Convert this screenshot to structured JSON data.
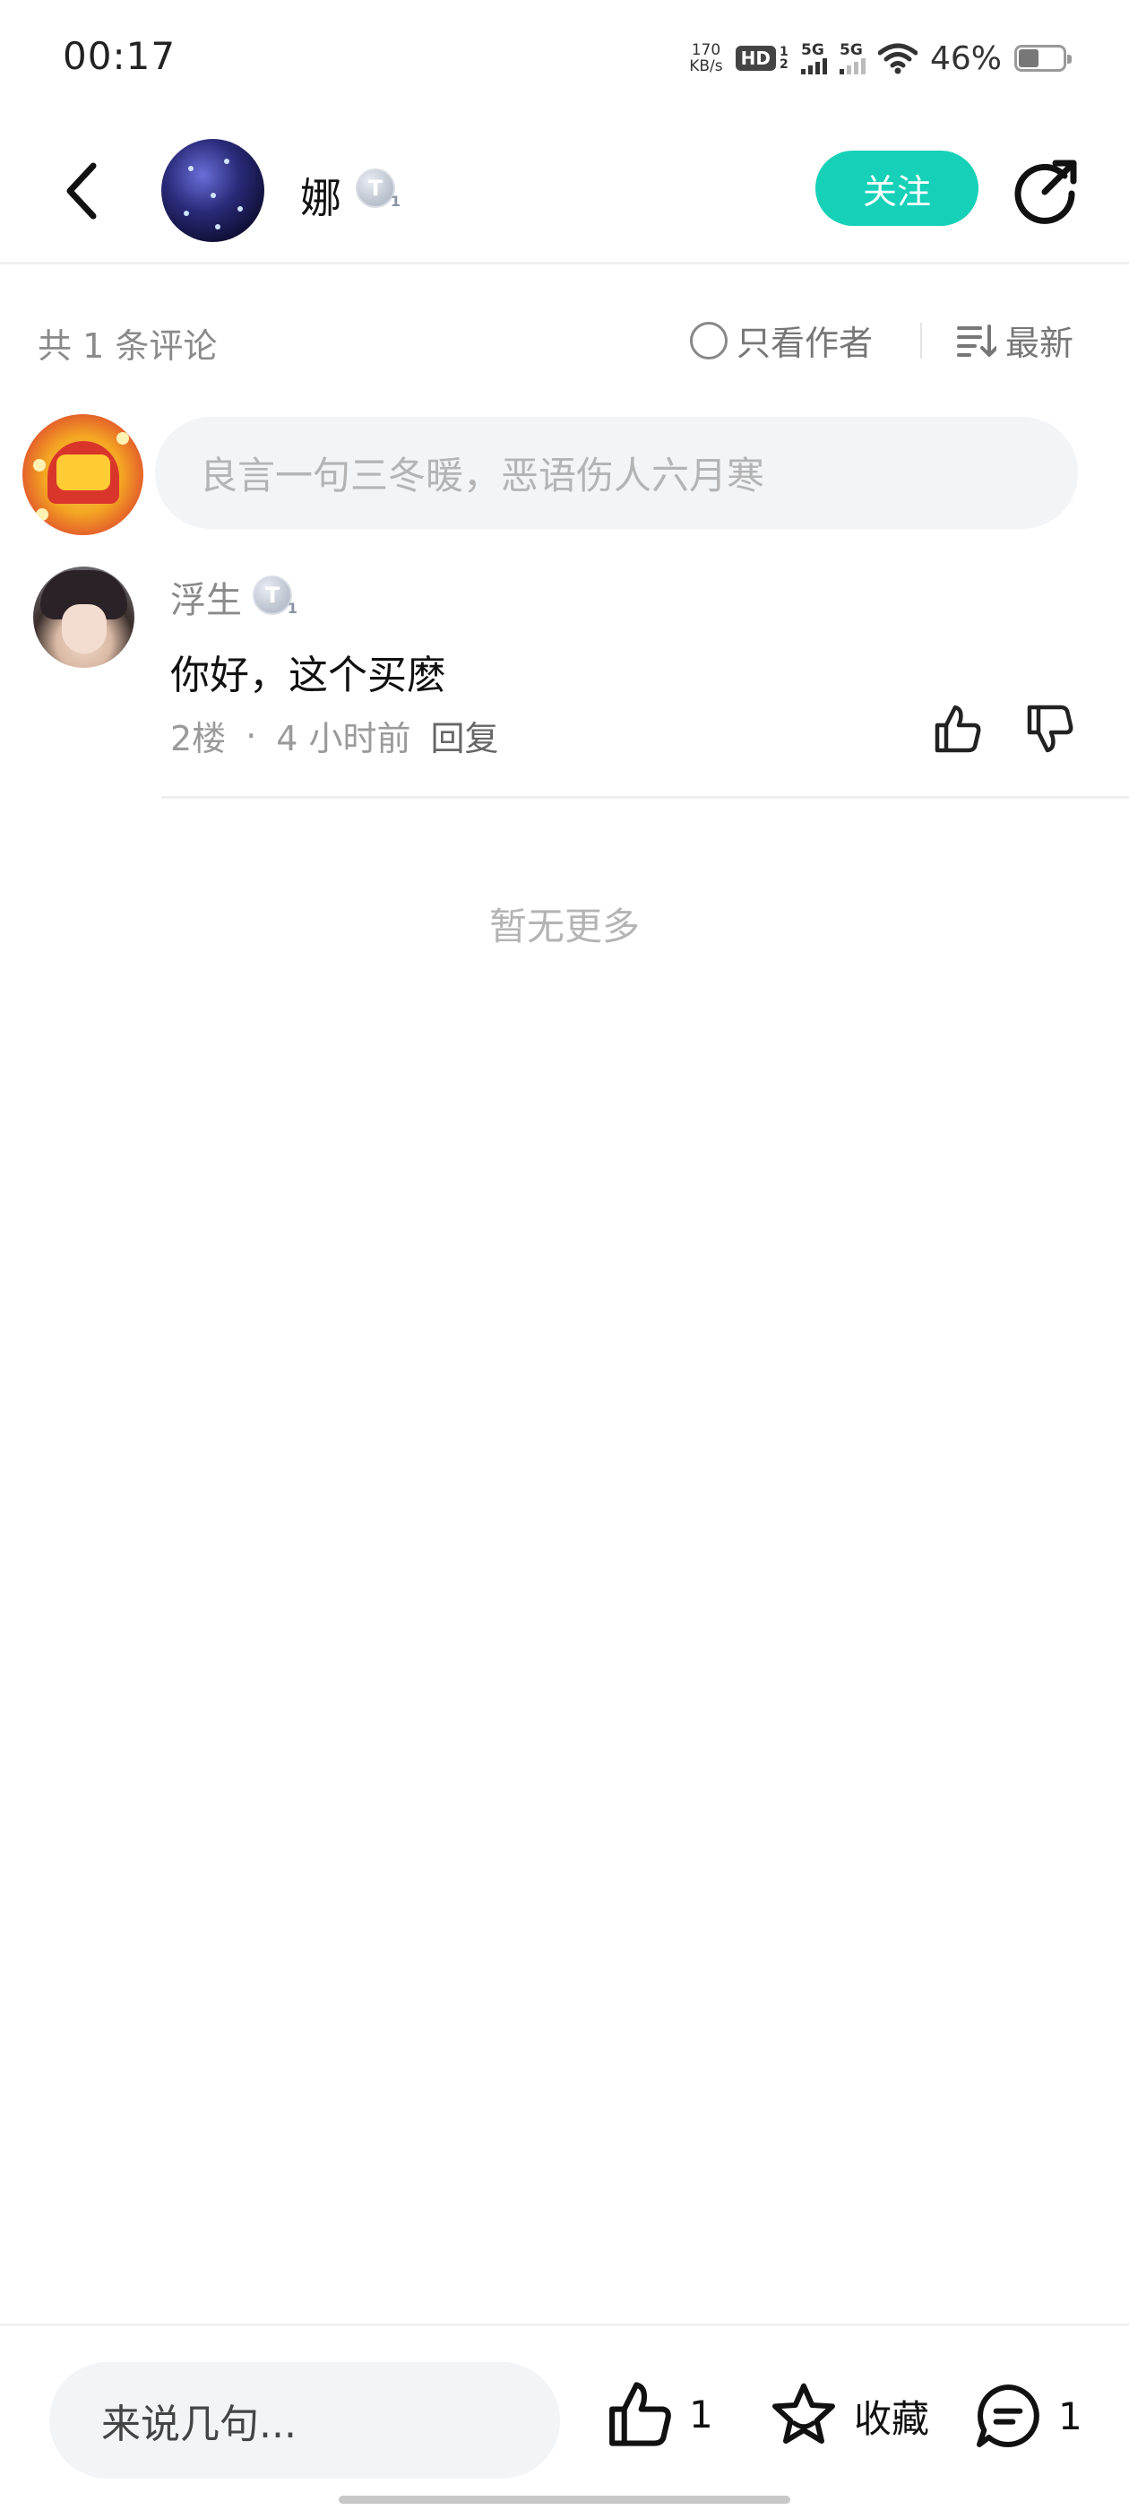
{
  "status_bar": {
    "time": "00:17",
    "net_speed_value": "170",
    "net_speed_unit": "KB/s",
    "hd_label": "HD",
    "hd_sim": "1 2",
    "sig1_label": "5G",
    "sig2_label": "5G",
    "battery_percent": "46%",
    "battery_level": 0.46,
    "icons": [
      "wifi-icon",
      "battery-icon"
    ]
  },
  "header": {
    "author_name": "娜",
    "level_badge": "T",
    "level_sub": "1",
    "follow_label": "关注",
    "icons": [
      "back-arrow-icon",
      "share-icon"
    ],
    "accent_color": "#16d0b8"
  },
  "filter_bar": {
    "comment_count": "共 1 条评论",
    "only_author_label": "只看作者",
    "sort_label": "最新"
  },
  "compose": {
    "placeholder": "良言一句三冬暖，恶语伤人六月寒"
  },
  "comments": [
    {
      "author": "浮生",
      "level_badge": "T",
      "level_sub": "1",
      "text": "你好，这个买麽",
      "floor": "2楼",
      "dot": "·",
      "time": "4 小时前",
      "reply_label": "回复"
    }
  ],
  "no_more_text": "暂无更多",
  "bottom_bar": {
    "input_placeholder": "来说几句...",
    "like_count": "1",
    "favorite_label": "收藏",
    "comment_count": "1"
  }
}
